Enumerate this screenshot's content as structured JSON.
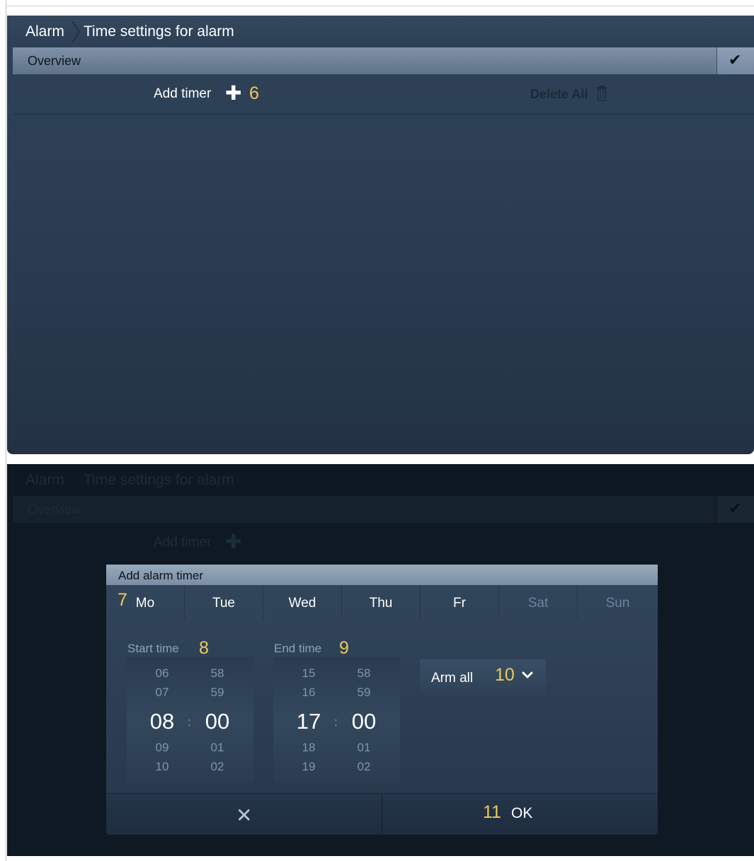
{
  "breadcrumb": {
    "root": "Alarm",
    "current": "Time settings for alarm"
  },
  "overview": {
    "label": "Overview",
    "confirm_icon": "check-icon"
  },
  "actions": {
    "add_timer": "Add timer",
    "delete_all": "Delete All"
  },
  "annotations": {
    "n6": "6",
    "n7": "7",
    "n8": "8",
    "n9": "9",
    "n10": "10",
    "n11": "11"
  },
  "dialog": {
    "title": "Add alarm timer",
    "days": [
      {
        "label": "Mo",
        "active": true
      },
      {
        "label": "Tue",
        "active": true
      },
      {
        "label": "Wed",
        "active": true
      },
      {
        "label": "Thu",
        "active": true
      },
      {
        "label": "Fr",
        "active": true
      },
      {
        "label": "Sat",
        "active": false
      },
      {
        "label": "Sun",
        "active": false
      }
    ],
    "start_time": {
      "label": "Start time",
      "hours": [
        "06",
        "07",
        "08",
        "09",
        "10"
      ],
      "minutes": [
        "58",
        "59",
        "00",
        "01",
        "02"
      ]
    },
    "end_time": {
      "label": "End time",
      "hours": [
        "15",
        "16",
        "17",
        "18",
        "19"
      ],
      "minutes": [
        "58",
        "59",
        "00",
        "01",
        "02"
      ]
    },
    "separator": ":",
    "arm_mode": {
      "selected": "Arm all"
    },
    "cancel_icon": "close-icon",
    "ok_label": "OK"
  },
  "colors": {
    "accent_number": "#efc95a",
    "overview_bar": "#7f91a6",
    "panel": "#2b3e53"
  }
}
